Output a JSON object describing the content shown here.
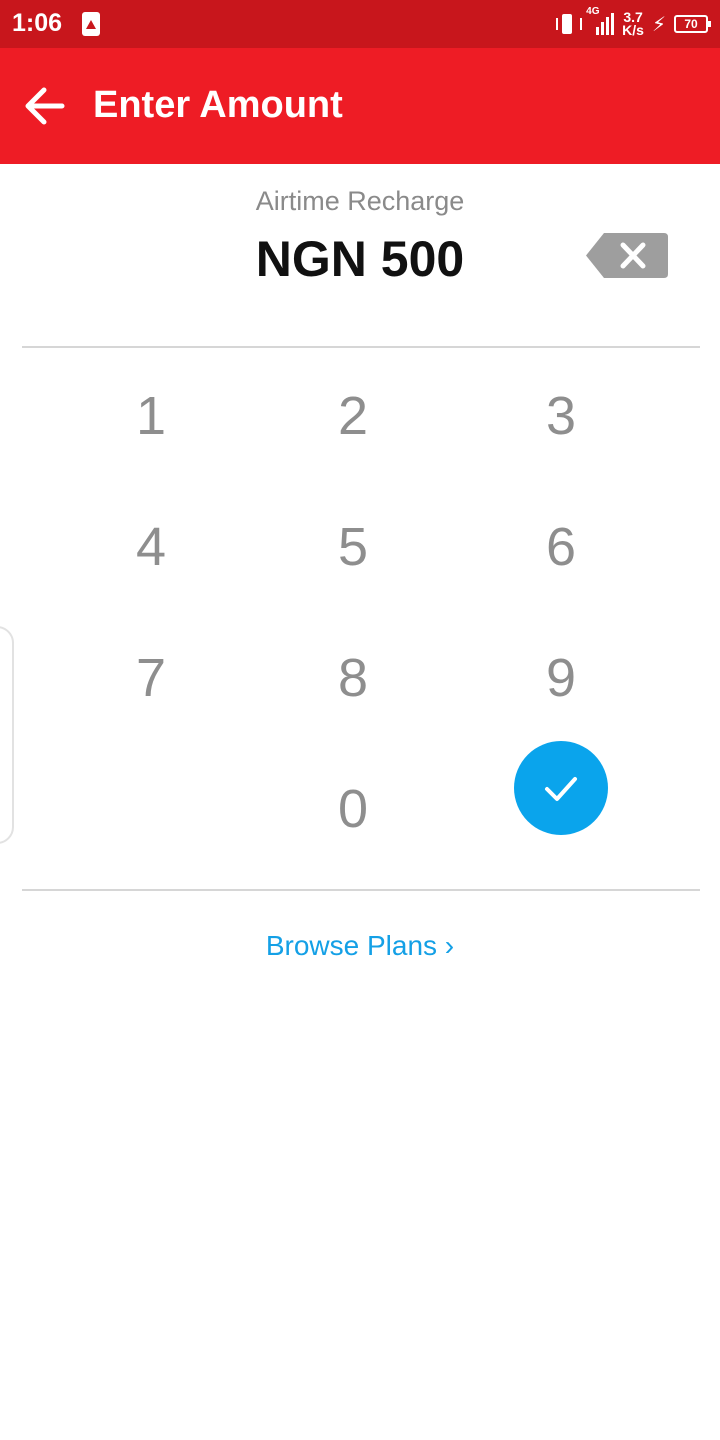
{
  "status_bar": {
    "time": "1:06",
    "network": "4G",
    "speed_value": "3.7",
    "speed_unit": "K/s",
    "battery": "70"
  },
  "app_bar": {
    "title": "Enter Amount",
    "back_icon": "arrow-left-icon",
    "background_color": "#ee1c25"
  },
  "amount": {
    "label": "Airtime Recharge",
    "value": "NGN 500",
    "backspace_icon": "backspace-icon"
  },
  "keypad": {
    "keys": [
      "1",
      "2",
      "3",
      "4",
      "5",
      "6",
      "7",
      "8",
      "9",
      "0"
    ],
    "submit_icon": "check-icon",
    "submit_color": "#0aa4ec"
  },
  "browse": {
    "label": "Browse Plans ›",
    "color": "#14a0e6"
  }
}
